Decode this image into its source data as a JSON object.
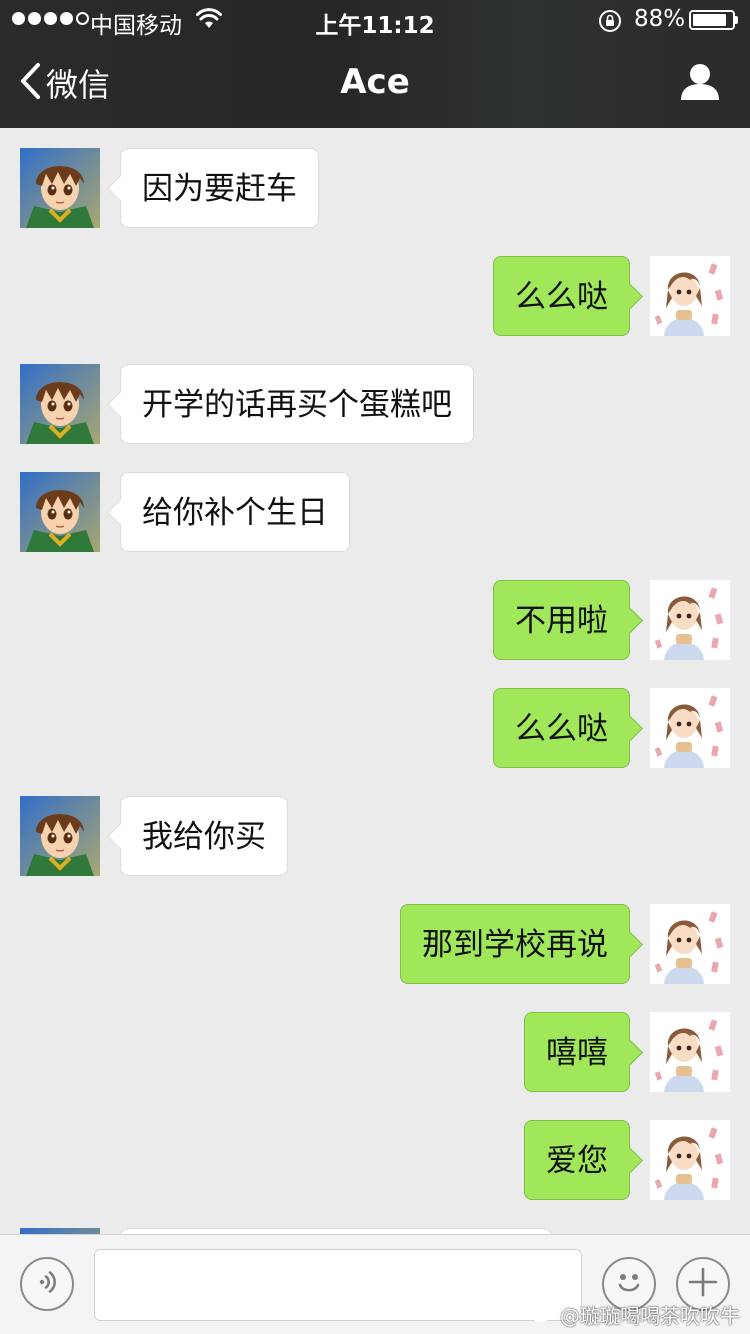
{
  "status_bar": {
    "carrier": "中国移动",
    "time": "上午11:12",
    "battery_percent": "88%",
    "battery_level": 0.88,
    "signal_bars_filled": 4,
    "signal_bars_total": 5
  },
  "nav": {
    "back_label": "微信",
    "title": "Ace"
  },
  "messages": [
    {
      "side": "left",
      "text": "因为要赶车"
    },
    {
      "side": "right",
      "text": "么么哒"
    },
    {
      "side": "left",
      "text": "开学的话再买个蛋糕吧"
    },
    {
      "side": "left",
      "text": "给你补个生日"
    },
    {
      "side": "right",
      "text": "不用啦"
    },
    {
      "side": "right",
      "text": "么么哒"
    },
    {
      "side": "left",
      "text": "我给你买"
    },
    {
      "side": "right",
      "text": "那到学校再说"
    },
    {
      "side": "right",
      "text": "嘻嘻"
    },
    {
      "side": "right",
      "text": "爱您"
    },
    {
      "side": "left",
      "text": ""
    }
  ],
  "input_bar": {
    "placeholder": "",
    "icons": [
      "voice-icon",
      "emoji-icon",
      "plus-icon"
    ]
  },
  "watermark": "@璇璇喝喝茶吹吹牛",
  "colors": {
    "sent_bubble": "#a0e75a",
    "received_bubble": "#ffffff",
    "chat_background": "#ebebeb",
    "header": "#2b2b2b"
  }
}
